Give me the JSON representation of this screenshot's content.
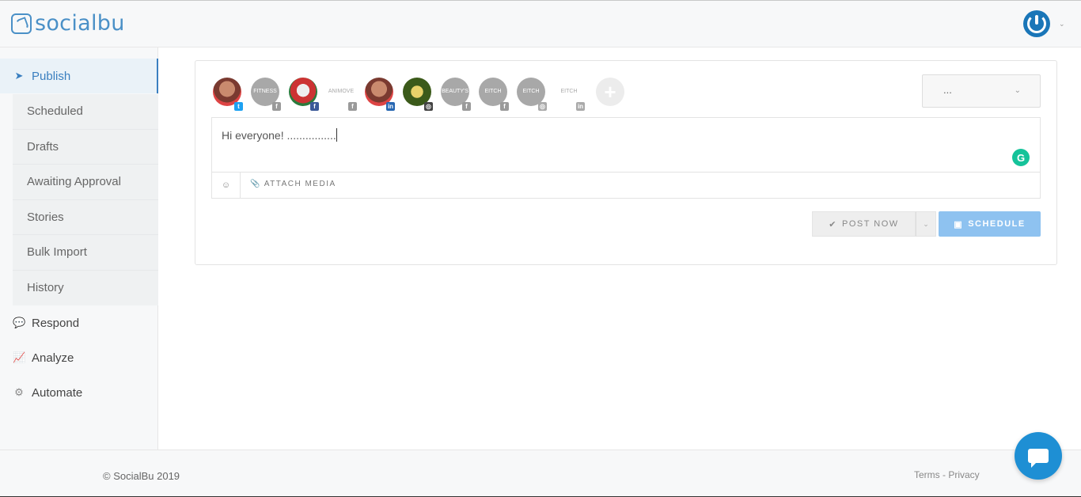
{
  "header": {
    "logo_text": "socialbu",
    "user_menu_caret": "⌄"
  },
  "sidebar": {
    "items": [
      {
        "label": "Publish",
        "icon": "paper-plane-icon",
        "active": true
      },
      {
        "label": "Respond",
        "icon": "chat-icon"
      },
      {
        "label": "Analyze",
        "icon": "line-chart-icon"
      },
      {
        "label": "Automate",
        "icon": "gears-icon"
      }
    ],
    "publish_submenu": [
      {
        "label": "Scheduled"
      },
      {
        "label": "Drafts"
      },
      {
        "label": "Awaiting Approval"
      },
      {
        "label": "Stories"
      },
      {
        "label": "Bulk Import"
      },
      {
        "label": "History"
      }
    ]
  },
  "composer": {
    "accounts": [
      {
        "picture": "",
        "network": "twitter"
      },
      {
        "picture": "FITNESS",
        "network": "facebook"
      },
      {
        "picture": "",
        "network": "facebook"
      },
      {
        "picture": "ANIMOVE",
        "network": "facebook"
      },
      {
        "picture": "",
        "network": "linkedin"
      },
      {
        "picture": "",
        "network": "instagram"
      },
      {
        "picture": "BEAUTY'S",
        "network": "facebook"
      },
      {
        "picture": "EITCH",
        "network": "facebook"
      },
      {
        "picture": "EITCH",
        "network": "instagram"
      },
      {
        "picture": "EITCH",
        "network": "linkedin"
      }
    ],
    "add_account_label": "+",
    "select_value": "...",
    "select_caret": "⌄",
    "message_text": "Hi everyone! ................",
    "grammarly_label": "G",
    "emoji_label": "☺",
    "attach_media_label": "ATTACH MEDIA",
    "post_now_label": "POST NOW",
    "schedule_label": "SCHEDULE",
    "colors": {
      "accent": "#3a7fc0",
      "schedule_button": "#8ec2f0",
      "grammarly": "#15c39a"
    }
  },
  "footer": {
    "copyright": "© SocialBu 2019",
    "links": "Terms - Privacy"
  }
}
